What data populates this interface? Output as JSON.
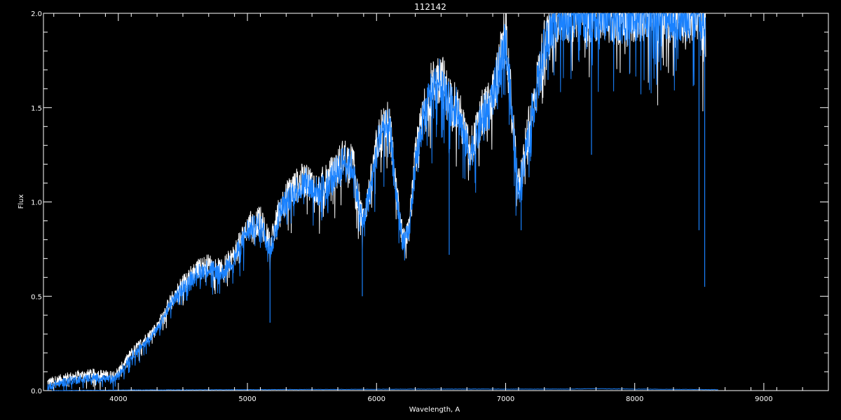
{
  "chart_data": {
    "type": "line",
    "title": "112142",
    "xlabel": "Wavelength, A",
    "ylabel": "Flux",
    "xlim": [
      3420,
      9500
    ],
    "ylim": [
      0.0,
      2.0
    ],
    "x_ticks": [
      4000,
      5000,
      6000,
      7000,
      8000,
      9000
    ],
    "x_tick_labels": [
      "4000",
      "5000",
      "6000",
      "7000",
      "8000",
      "9000"
    ],
    "y_ticks": [
      0.0,
      0.5,
      1.0,
      1.5,
      2.0
    ],
    "y_tick_labels": [
      "0.0",
      "0.5",
      "1.0",
      "1.5",
      "2.0"
    ],
    "grid": false,
    "background": "#000000",
    "axis_color": "#ffffff",
    "series": [
      {
        "color": "#ffffff",
        "x": [
          3450,
          3600,
          3800,
          3950,
          4000,
          4100,
          4200,
          4300,
          4400,
          4500,
          4600,
          4700,
          4800,
          4900,
          5000,
          5100,
          5180,
          5250,
          5350,
          5450,
          5550,
          5650,
          5750,
          5820,
          5890,
          5950,
          6020,
          6100,
          6150,
          6200,
          6250,
          6300,
          6350,
          6420,
          6500,
          6560,
          6620,
          6680,
          6720,
          6780,
          6820,
          6880,
          6950,
          7000,
          7050,
          7100,
          7150,
          7200,
          7300,
          7400,
          7500,
          7600,
          7700,
          7800,
          7900,
          8000,
          8100,
          8200,
          8300,
          8400,
          8500,
          8550
        ],
        "y": [
          0.02,
          0.05,
          0.07,
          0.06,
          0.08,
          0.18,
          0.25,
          0.32,
          0.45,
          0.55,
          0.62,
          0.65,
          0.62,
          0.7,
          0.85,
          0.88,
          0.75,
          0.95,
          1.05,
          1.1,
          1.05,
          1.12,
          1.22,
          1.18,
          0.88,
          1.05,
          1.35,
          1.4,
          1.05,
          0.8,
          0.82,
          1.2,
          1.4,
          1.58,
          1.65,
          1.52,
          1.5,
          1.35,
          1.25,
          1.35,
          1.45,
          1.5,
          1.7,
          1.88,
          1.45,
          1.05,
          1.25,
          1.45,
          1.8,
          2.0,
          2.0,
          2.0,
          2.0,
          2.0,
          2.0,
          2.0,
          2.0,
          2.0,
          2.0,
          2.0,
          2.0,
          1.9
        ]
      },
      {
        "color": "#1a82ff",
        "x": [
          3450,
          3600,
          3800,
          3950,
          4000,
          4100,
          4200,
          4300,
          4400,
          4500,
          4600,
          4700,
          4800,
          4900,
          5000,
          5100,
          5180,
          5250,
          5350,
          5450,
          5550,
          5650,
          5750,
          5820,
          5890,
          5950,
          6020,
          6100,
          6150,
          6200,
          6250,
          6300,
          6350,
          6420,
          6500,
          6560,
          6620,
          6680,
          6720,
          6780,
          6820,
          6880,
          6950,
          7000,
          7050,
          7100,
          7150,
          7200,
          7300,
          7400,
          7500,
          7600,
          7700,
          7800,
          7900,
          8000,
          8100,
          8200,
          8300,
          8400,
          8500,
          8550
        ],
        "y": [
          0.02,
          0.05,
          0.07,
          0.06,
          0.08,
          0.18,
          0.25,
          0.32,
          0.45,
          0.55,
          0.62,
          0.65,
          0.62,
          0.7,
          0.85,
          0.88,
          0.75,
          0.95,
          1.05,
          1.1,
          1.05,
          1.12,
          1.22,
          1.18,
          0.88,
          1.05,
          1.35,
          1.4,
          1.05,
          0.8,
          0.82,
          1.2,
          1.4,
          1.58,
          1.65,
          1.52,
          1.5,
          1.35,
          1.25,
          1.35,
          1.45,
          1.5,
          1.7,
          1.88,
          1.45,
          1.05,
          1.25,
          1.45,
          1.8,
          2.0,
          2.0,
          2.0,
          2.0,
          2.0,
          2.0,
          2.0,
          2.0,
          2.0,
          2.0,
          2.0,
          2.0,
          1.9
        ]
      },
      {
        "color": "#1a82ff",
        "x": [
          3450,
          4000,
          5000,
          6000,
          6500,
          7000,
          7500,
          7650,
          8000,
          8500,
          8650
        ],
        "y": [
          0.0,
          0.003,
          0.005,
          0.007,
          0.008,
          0.008,
          0.008,
          0.01,
          0.008,
          0.006,
          0.005
        ]
      }
    ],
    "absorption_lines": [
      {
        "x": 5175,
        "y": 0.36
      },
      {
        "x": 5890,
        "y": 0.5
      },
      {
        "x": 6563,
        "y": 0.72
      },
      {
        "x": 7120,
        "y": 0.85
      },
      {
        "x": 7665,
        "y": 1.25
      },
      {
        "x": 8498,
        "y": 0.85
      },
      {
        "x": 8542,
        "y": 0.55
      }
    ]
  }
}
